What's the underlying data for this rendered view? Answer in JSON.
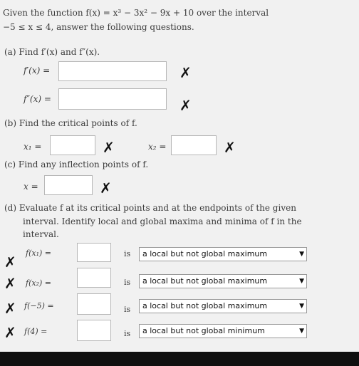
{
  "intro": {
    "line1": "Given the function f(x) = x³ − 3x² − 9x + 10 over the interval",
    "line2": "−5 ≤ x ≤ 4, answer the following questions."
  },
  "part_a": {
    "heading": "(a) Find f′(x) and f″(x).",
    "label1": "f′(x) =",
    "label2": "f″(x) =",
    "value1": "",
    "value2": ""
  },
  "part_b": {
    "heading": "(b) Find the critical points of f.",
    "label1": "x₁ =",
    "label2": "x₂ =",
    "value1": "",
    "value2": ""
  },
  "part_c": {
    "heading": "(c) Find any inflection points of f.",
    "label1": "x =",
    "value1": ""
  },
  "part_d": {
    "line1": "(d) Evaluate f at its critical points and at the endpoints of the given",
    "line2": "interval. Identify local and global maxima and minima of f in the",
    "line3": "interval.",
    "rows": [
      {
        "label": "f(x₁) =",
        "is": "is",
        "selected": "a local but not global maximum"
      },
      {
        "label": "f(x₂) =",
        "is": "is",
        "selected": "a local but not global maximum"
      },
      {
        "label": "f(−5) =",
        "is": "is",
        "selected": "a local but not global maximum"
      },
      {
        "label": "f(4) =",
        "is": "is",
        "selected": "a local but not global minimum"
      }
    ]
  },
  "marks": {
    "wrong": "✗"
  },
  "icons": {
    "wrong": "x-mark-icon",
    "dropdown": "triangle-down-icon"
  },
  "colors": {
    "background": "#f1f1f1",
    "bottom_bar": "#0f0f0f"
  }
}
